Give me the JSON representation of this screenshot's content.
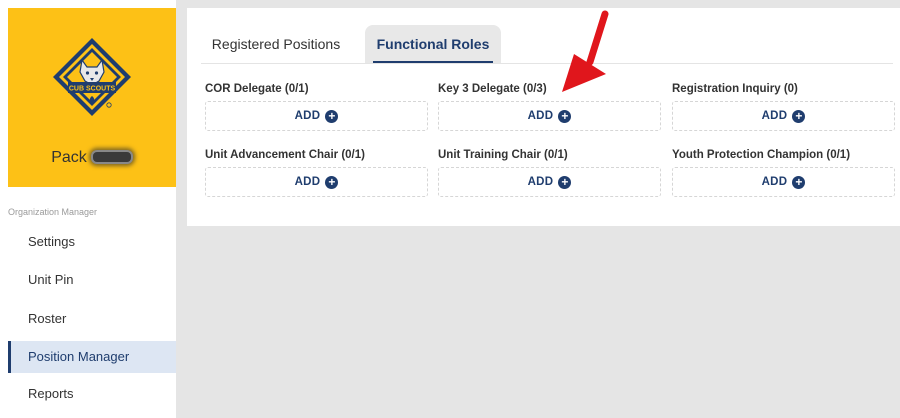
{
  "sidebar": {
    "pack_label": "Pack",
    "section_label": "Organization Manager",
    "items": [
      {
        "label": "Settings",
        "active": false
      },
      {
        "label": "Unit Pin",
        "active": false
      },
      {
        "label": "Roster",
        "active": false
      },
      {
        "label": "Position Manager",
        "active": true
      },
      {
        "label": "Reports",
        "active": false
      }
    ],
    "logo_text": "CUB SCOUTS",
    "brand_color": "#fdc116"
  },
  "tabs": [
    {
      "label": "Registered Positions",
      "active": false
    },
    {
      "label": "Functional Roles",
      "active": true
    }
  ],
  "roles": [
    {
      "label": "COR Delegate (0/1)",
      "add_label": "ADD"
    },
    {
      "label": "Key 3 Delegate (0/3)",
      "add_label": "ADD"
    },
    {
      "label": "Registration Inquiry (0)",
      "add_label": "ADD"
    },
    {
      "label": "Unit Advancement Chair (0/1)",
      "add_label": "ADD"
    },
    {
      "label": "Unit Training Chair (0/1)",
      "add_label": "ADD"
    },
    {
      "label": "Youth Protection Champion (0/1)",
      "add_label": "ADD"
    }
  ],
  "colors": {
    "accent": "#1f3d6e",
    "annotation_arrow": "#e0161c",
    "active_nav_bg": "#dde6f3"
  },
  "icons": {
    "add": "plus-circle-icon",
    "annotation": "red-arrow-icon"
  }
}
